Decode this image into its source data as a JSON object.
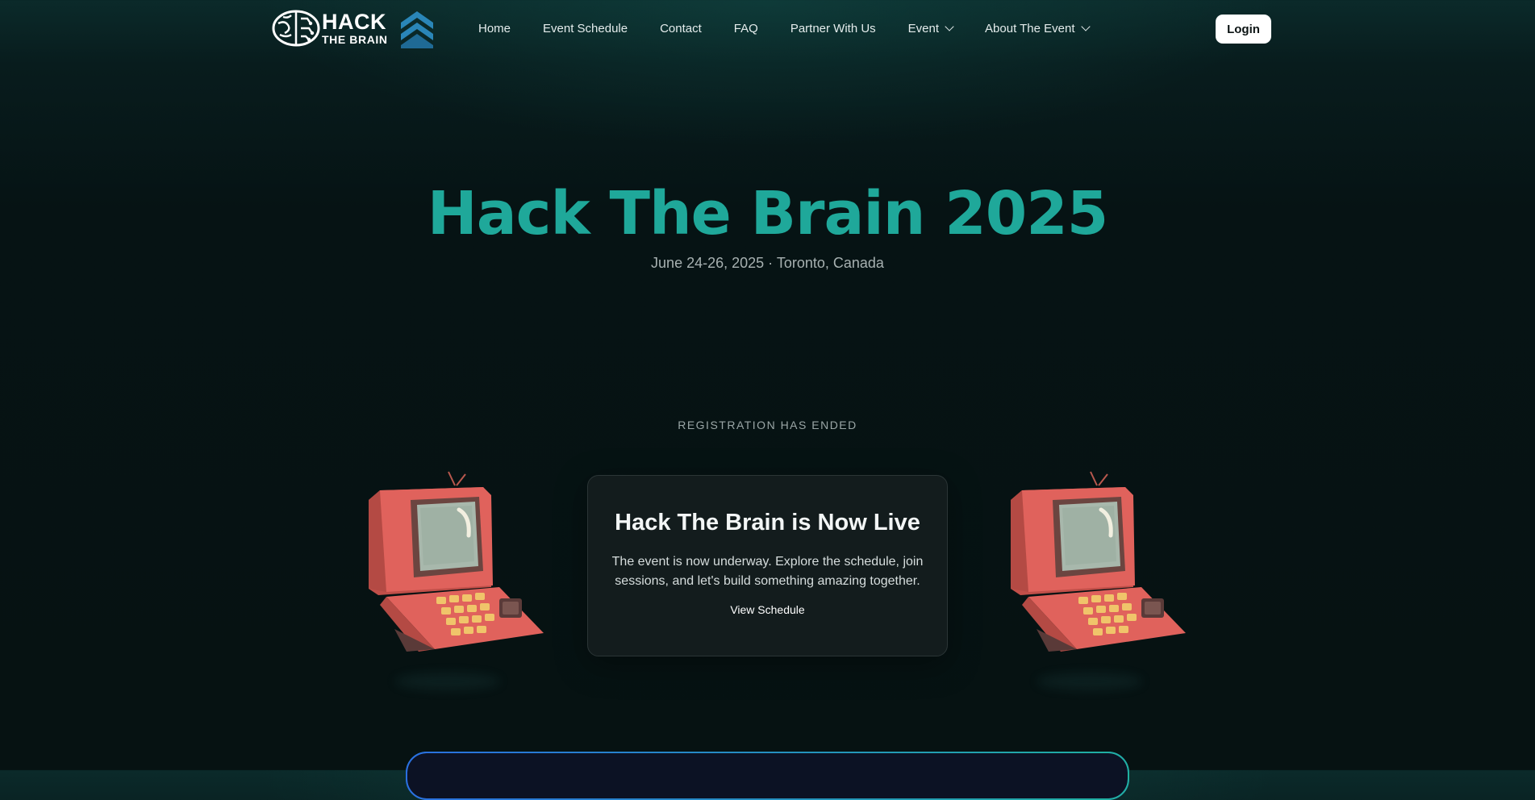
{
  "nav": {
    "logo_line1": "HACK",
    "logo_line2": "THE BRAIN",
    "links": [
      {
        "label": "Home"
      },
      {
        "label": "Event Schedule"
      },
      {
        "label": "Contact"
      },
      {
        "label": "FAQ"
      },
      {
        "label": "Partner With Us"
      },
      {
        "label": "Event",
        "has_dropdown": true
      },
      {
        "label": "About The Event",
        "has_dropdown": true
      }
    ],
    "login_label": "Login"
  },
  "hero": {
    "title": "Hack The Brain 2025",
    "subtitle": "June 24-26, 2025 · Toronto, Canada"
  },
  "registration_status": "REGISTRATION HAS ENDED",
  "card": {
    "title": "Hack The Brain is Now Live",
    "text": "The event is now underway. Explore the schedule, join sessions, and let's build something amazing together.",
    "button_label": "View Schedule"
  },
  "colors": {
    "accent_teal": "#1fa89a",
    "background": "#061314",
    "card_bg": "#131c1d",
    "computer_red": "#e0625c",
    "logo_chevron": "#2a86b8"
  },
  "icons": {
    "logo": "brain-icon",
    "logo_secondary": "chevron-up-icon",
    "illustration": "retro-computer-icon"
  }
}
